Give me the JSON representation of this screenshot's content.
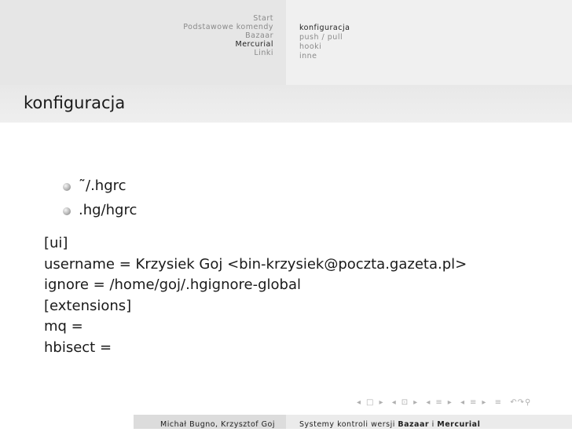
{
  "header": {
    "sections": [
      {
        "label": "Start",
        "active": false
      },
      {
        "label": "Podstawowe komendy",
        "active": false
      },
      {
        "label": "Bazaar",
        "active": false
      },
      {
        "label": "Mercurial",
        "active": true
      },
      {
        "label": "Linki",
        "active": false
      }
    ],
    "subsections": [
      {
        "label": "konfiguracja",
        "active": true
      },
      {
        "label": "push / pull",
        "active": false
      },
      {
        "label": "hooki",
        "active": false
      },
      {
        "label": "inne",
        "active": false
      }
    ]
  },
  "slide": {
    "title": "konfiguracja",
    "bullets": [
      "˜/.hgrc",
      ".hg/hgrc"
    ],
    "code_lines": [
      "[ui]",
      "username = Krzysiek Goj <bin-krzysiek@poczta.gazeta.pl>",
      "ignore = /home/goj/.hgignore-global",
      "[extensions]",
      "mq =",
      "hbisect ="
    ]
  },
  "footer": {
    "authors": "Michał Bugno, Krzysztof Goj",
    "title_prefix": "Systemy kontroli wersji ",
    "title_bold_1": "Bazaar",
    "title_mid": " i ",
    "title_bold_2": "Mercurial"
  },
  "navigation": {
    "symbols": [
      "◂",
      "□",
      "▸",
      "◂",
      "⊡",
      "▸",
      "◂",
      "≡",
      "▸",
      "◂",
      "≡",
      "▸",
      "≡",
      "↶↷⚲"
    ]
  }
}
